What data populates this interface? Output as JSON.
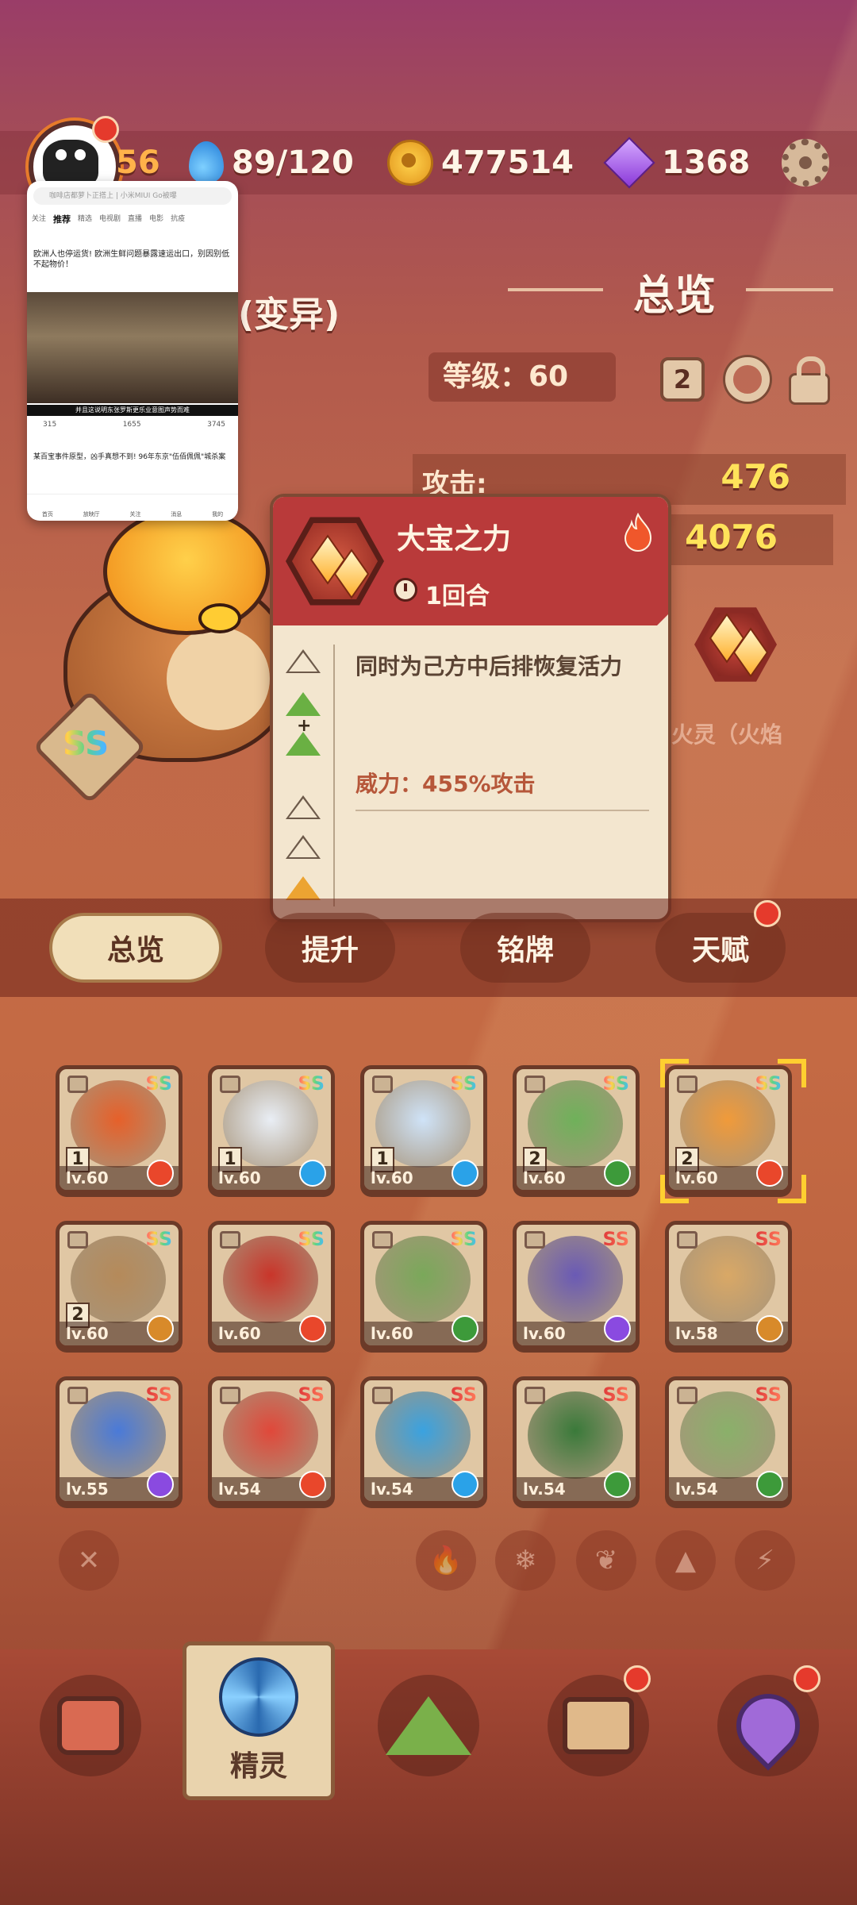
{
  "status": {
    "level": "56",
    "water": "89/120",
    "coins": "477514",
    "gems": "1368"
  },
  "overview": {
    "title": "总览",
    "level_label": "等级：60",
    "count_badge": "2",
    "stats": [
      {
        "label": "攻击:",
        "value": "476"
      },
      {
        "label": "",
        "value": "4076"
      }
    ],
    "mutation_text": "(变异)",
    "element_text": "火灵（火焰"
  },
  "skill_popup": {
    "name": "大宝之力",
    "cooldown": "1回合",
    "description": "同时为己方中后排恢复活力",
    "power": "威力：455%攻击"
  },
  "tabs": [
    {
      "label": "总览",
      "active": true
    },
    {
      "label": "提升",
      "active": false
    },
    {
      "label": "铭牌",
      "active": false
    },
    {
      "label": "天赋",
      "active": false
    }
  ],
  "monsters": [
    {
      "rank": "SS",
      "level": "lv.60",
      "count": "1",
      "element": "fire",
      "art": "#e6602a"
    },
    {
      "rank": "SS",
      "level": "lv.60",
      "count": "1",
      "element": "ice",
      "art": "#e9eef5"
    },
    {
      "rank": "SS",
      "level": "lv.60",
      "count": "1",
      "element": "ice",
      "art": "#cfe3f8"
    },
    {
      "rank": "SS",
      "level": "lv.60",
      "count": "2",
      "element": "leaf",
      "art": "#6fb15a"
    },
    {
      "rank": "SS",
      "level": "lv.60",
      "count": "2",
      "element": "fire",
      "art": "#f09a3a"
    },
    {
      "rank": "SS",
      "level": "lv.60",
      "count": "2",
      "element": "earth",
      "art": "#b58a5a"
    },
    {
      "rank": "SS",
      "level": "lv.60",
      "count": "",
      "element": "fire",
      "art": "#c9352a"
    },
    {
      "rank": "SS",
      "level": "lv.60",
      "count": "",
      "element": "leaf",
      "art": "#7aa85a"
    },
    {
      "rank": "SS",
      "level": "lv.60",
      "count": "",
      "element": "bolt",
      "art": "#6a5ab5"
    },
    {
      "rank": "SS",
      "level": "lv.58",
      "count": "",
      "element": "earth",
      "art": "#d9a866"
    },
    {
      "rank": "SS",
      "level": "lv.55",
      "count": "",
      "element": "bolt",
      "art": "#4a7ad8"
    },
    {
      "rank": "SS",
      "level": "lv.54",
      "count": "",
      "element": "fire",
      "art": "#e0483a"
    },
    {
      "rank": "SS",
      "level": "lv.54",
      "count": "",
      "element": "ice",
      "art": "#3aa2e0"
    },
    {
      "rank": "SS",
      "level": "lv.54",
      "count": "",
      "element": "leaf",
      "art": "#3a7a3a"
    },
    {
      "rank": "SS",
      "level": "lv.54",
      "count": "",
      "element": "leaf",
      "art": "#8ab06a"
    }
  ],
  "filters": [
    "close-icon",
    "fire-icon",
    "ice-icon",
    "leaf-icon",
    "earth-icon",
    "bolt-icon"
  ],
  "nav": {
    "active_label": "精灵"
  },
  "thumbnail": {
    "search": "咖啡店都萝卜正搭上 | 小米MIUI Go被曝",
    "tabs": [
      "关注",
      "推荐",
      "精选",
      "电视剧",
      "直播",
      "电影",
      "抗疫"
    ],
    "post_title": "欧洲人也停运货! 欧洲生鲜问题暴露速运出口，别因别低不起物价！",
    "caption": "并且这说明东张罗斯更乐业意图声势而难",
    "likes": "315",
    "comments": "1655",
    "shares": "3745",
    "post2": "某百宝事件原型，凶手真想不到! 96年东京\"伍佰佩佩\"城杀案",
    "nav": [
      "首页",
      "放映厅",
      "关注",
      "消息",
      "我的"
    ]
  }
}
